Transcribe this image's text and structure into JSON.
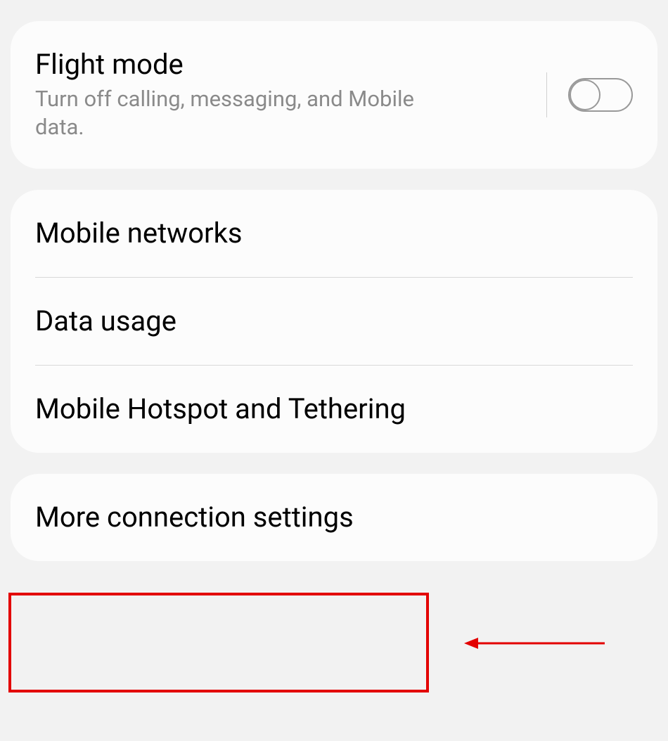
{
  "flightMode": {
    "title": "Flight mode",
    "subtitle": "Turn off calling, messaging, and Mobile data.",
    "enabled": false
  },
  "networkGroup": {
    "mobileNetworks": "Mobile networks",
    "dataUsage": "Data usage",
    "hotspot": "Mobile Hotspot and Tethering"
  },
  "moreSettings": {
    "title": "More connection settings"
  }
}
